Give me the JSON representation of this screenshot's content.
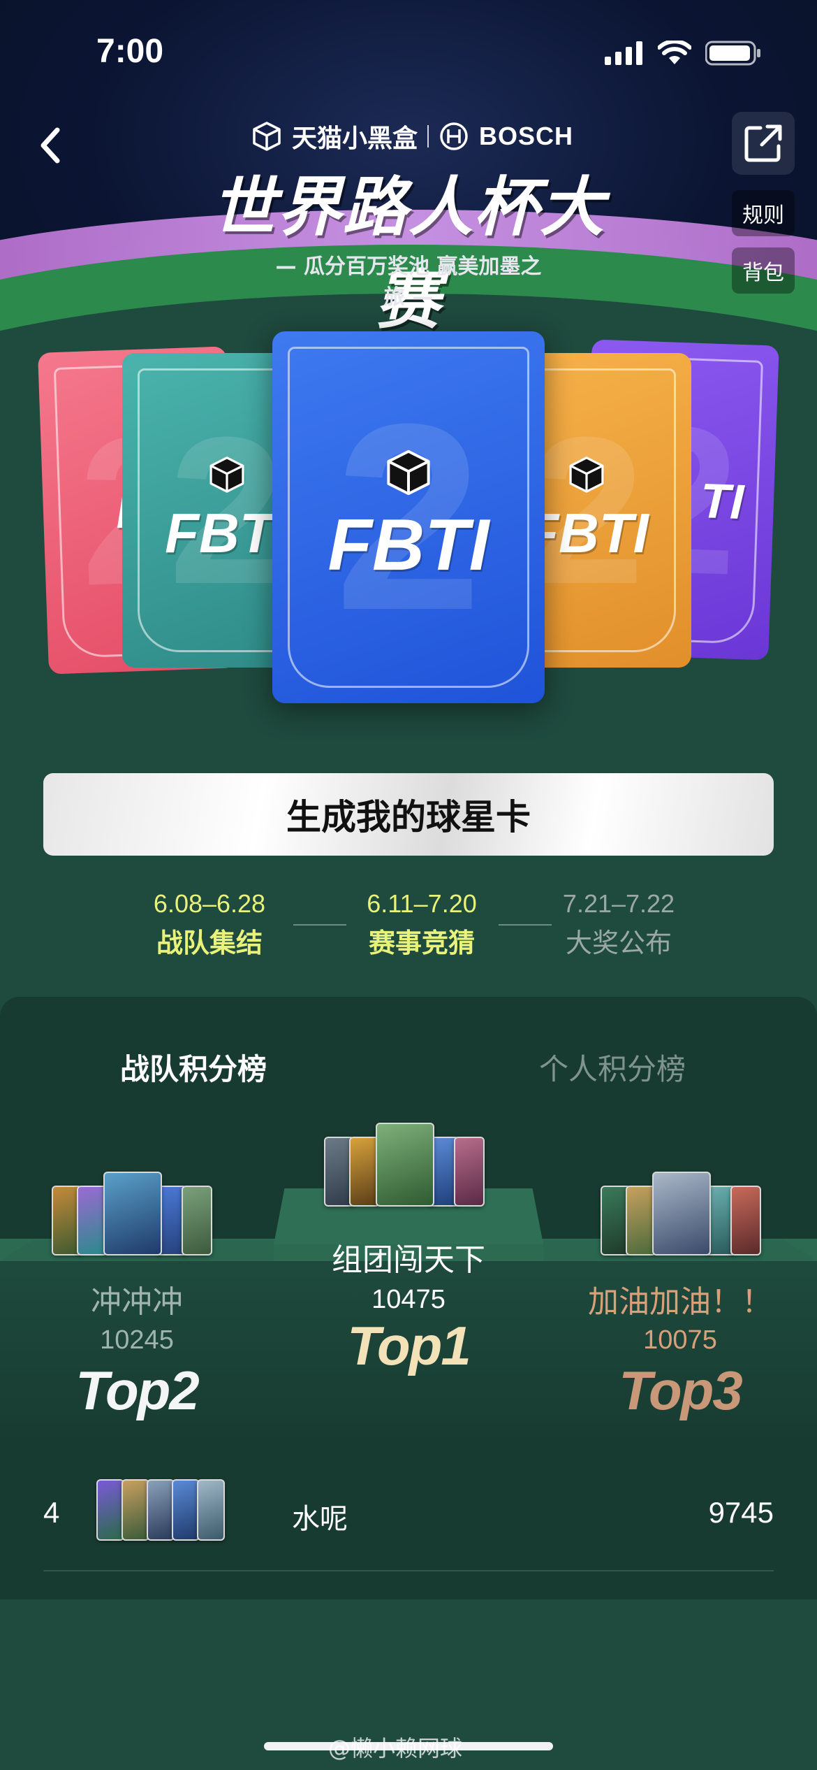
{
  "status_bar": {
    "time": "7:00"
  },
  "header": {
    "brand_left": "天猫小黑盒",
    "brand_right": "BOSCH",
    "title": "世界路人杯大赛",
    "subtitle": "— 瓜分百万奖池 赢美加墨之旅 —",
    "side_buttons": {
      "rules": "规则",
      "backpack": "背包"
    }
  },
  "cards": {
    "logo": "FBTI",
    "partial_logo_left": "FI",
    "partial_logo_right": "TI"
  },
  "generate_button": "生成我的球星卡",
  "timeline": [
    {
      "date": "6.08–6.28",
      "label": "战队集结",
      "state": "active"
    },
    {
      "date": "6.11–7.20",
      "label": "赛事竞猜",
      "state": "active"
    },
    {
      "date": "7.21–7.22",
      "label": "大奖公布",
      "state": "inactive"
    }
  ],
  "leaderboard": {
    "tabs": {
      "team": "战队积分榜",
      "personal": "个人积分榜"
    },
    "podium": {
      "first": {
        "name": "组团闯天下",
        "score": "10475",
        "badge": "Top1"
      },
      "second": {
        "name": "冲冲冲",
        "score": "10245",
        "badge": "Top2"
      },
      "third": {
        "name": "加油加油！！",
        "score": "10075",
        "badge": "Top3"
      }
    },
    "rows": [
      {
        "rank": "4",
        "name": "水呢",
        "score": "9745"
      }
    ]
  },
  "watermark": "@懒小赖网球",
  "colors": {
    "background": "#1f4a3e",
    "active_timeline": "#e9f27a",
    "third_place": "#d9a07a"
  }
}
